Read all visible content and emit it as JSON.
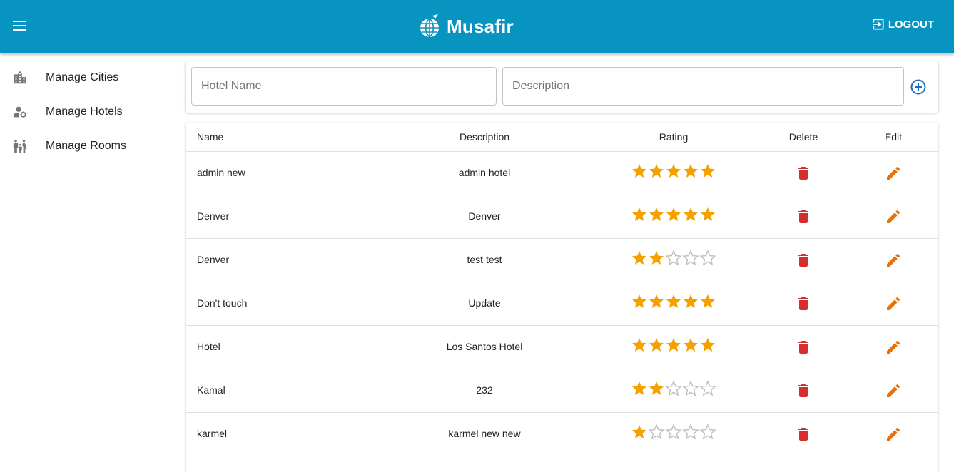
{
  "colors": {
    "primary": "#0894c0",
    "star": "#f4a100",
    "star_empty": "#bdbdbd",
    "delete": "#d32f2f",
    "edit": "#e8710a",
    "add": "#1e6fc0"
  },
  "appbar": {
    "menu_icon": "menu-icon",
    "logo_icon": "globe-plane-icon",
    "title": "Musafir",
    "logout_icon": "logout-icon",
    "logout_label": "LOGOUT"
  },
  "sidebar": {
    "items": [
      {
        "label": "Manage Cities",
        "icon": "city-icon"
      },
      {
        "label": "Manage Hotels",
        "icon": "user-gear-icon"
      },
      {
        "label": "Manage Rooms",
        "icon": "family-icon"
      }
    ]
  },
  "form": {
    "name_placeholder": "Hotel Name",
    "description_placeholder": "Description",
    "add_icon": "add-circle-icon"
  },
  "table": {
    "headers": {
      "name": "Name",
      "description": "Description",
      "rating": "Rating",
      "delete": "Delete",
      "edit": "Edit"
    },
    "max_rating": 5,
    "rows": [
      {
        "name": "admin new",
        "description": "admin hotel",
        "rating": 5
      },
      {
        "name": "Denver",
        "description": "Denver",
        "rating": 5
      },
      {
        "name": "Denver",
        "description": "test test",
        "rating": 2
      },
      {
        "name": "Don't touch",
        "description": "Update",
        "rating": 5
      },
      {
        "name": "Hotel",
        "description": "Los Santos Hotel",
        "rating": 5
      },
      {
        "name": "Kamal",
        "description": "232",
        "rating": 2
      },
      {
        "name": "karmel",
        "description": "karmel new new",
        "rating": 1
      }
    ]
  }
}
